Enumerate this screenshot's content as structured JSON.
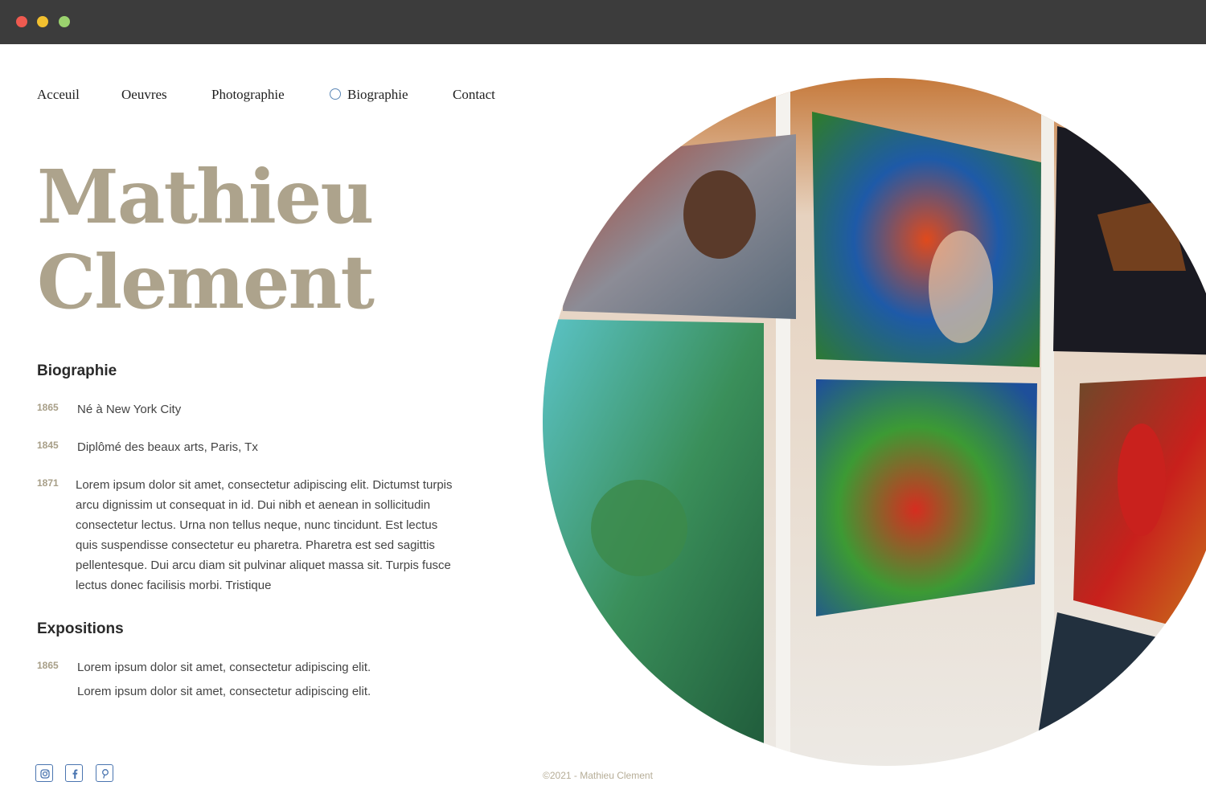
{
  "nav": {
    "items": [
      "Acceuil",
      "Oeuvres",
      "Photographie",
      "Biographie",
      "Contact"
    ],
    "active": "Biographie"
  },
  "hero": {
    "first_name": "Mathieu",
    "last_name": "Clement"
  },
  "biographie": {
    "title": "Biographie",
    "entries": [
      {
        "year": "1865",
        "text": "Né à New York City"
      },
      {
        "year": "1845",
        "text": "Diplômé des beaux arts, Paris, Tx"
      },
      {
        "year": "1871",
        "text": "Lorem ipsum dolor sit amet, consectetur adipiscing elit. Dictumst turpis arcu dignissim ut consequat in id. Dui nibh et aenean in sollicitudin consectetur lectus. Urna non tellus neque, nunc tincidunt. Est lectus quis suspendisse consectetur eu pharetra. Pharetra est sed sagittis pellentesque. Dui arcu diam sit pulvinar aliquet massa sit. Turpis fusce lectus donec facilisis morbi. Tristique"
      }
    ]
  },
  "expositions": {
    "title": "Expositions",
    "entries": [
      {
        "year": "1865",
        "lines": [
          "Lorem ipsum dolor sit amet, consectetur adipiscing elit.",
          "Lorem ipsum dolor sit amet, consectetur adipiscing elit."
        ]
      }
    ]
  },
  "social": [
    "instagram-icon",
    "facebook-icon",
    "pinterest-icon"
  ],
  "footer": {
    "copyright": "©2021 - Mathieu Clement"
  },
  "colors": {
    "accent": "#ada38c",
    "icon": "#4a75b0",
    "titlebar": "#3c3c3c"
  }
}
